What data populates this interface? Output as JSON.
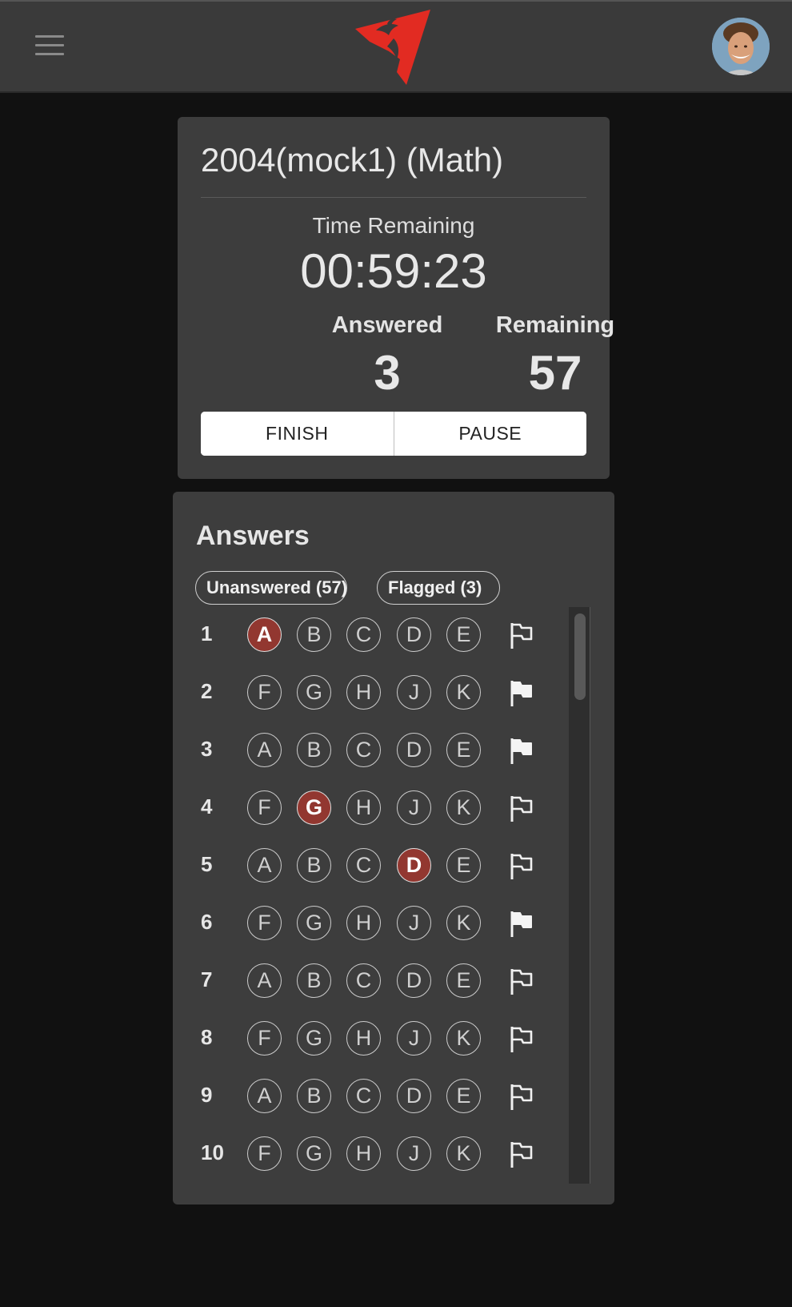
{
  "header": {
    "menu_icon": "hamburger-icon",
    "logo_icon": "red-bird-logo-icon",
    "avatar_icon": "user-avatar"
  },
  "exam": {
    "title": "2004(mock1) (Math)",
    "time_label": "Time Remaining",
    "time_value": "00:59:23",
    "answered_label": "Answered",
    "answered_value": "3",
    "remaining_label": "Remaining",
    "remaining_value": "57",
    "finish_label": "FINISH",
    "pause_label": "PAUSE"
  },
  "answers": {
    "title": "Answers",
    "filter_unanswered": "Unanswered (57)",
    "filter_flagged": "Flagged (3)",
    "rows": [
      {
        "num": "1",
        "options": [
          "A",
          "B",
          "C",
          "D",
          "E"
        ],
        "selected": "A",
        "flagged": false
      },
      {
        "num": "2",
        "options": [
          "F",
          "G",
          "H",
          "J",
          "K"
        ],
        "selected": null,
        "flagged": true
      },
      {
        "num": "3",
        "options": [
          "A",
          "B",
          "C",
          "D",
          "E"
        ],
        "selected": null,
        "flagged": true
      },
      {
        "num": "4",
        "options": [
          "F",
          "G",
          "H",
          "J",
          "K"
        ],
        "selected": "G",
        "flagged": false
      },
      {
        "num": "5",
        "options": [
          "A",
          "B",
          "C",
          "D",
          "E"
        ],
        "selected": "D",
        "flagged": false
      },
      {
        "num": "6",
        "options": [
          "F",
          "G",
          "H",
          "J",
          "K"
        ],
        "selected": null,
        "flagged": true
      },
      {
        "num": "7",
        "options": [
          "A",
          "B",
          "C",
          "D",
          "E"
        ],
        "selected": null,
        "flagged": false
      },
      {
        "num": "8",
        "options": [
          "F",
          "G",
          "H",
          "J",
          "K"
        ],
        "selected": null,
        "flagged": false
      },
      {
        "num": "9",
        "options": [
          "A",
          "B",
          "C",
          "D",
          "E"
        ],
        "selected": null,
        "flagged": false
      },
      {
        "num": "10",
        "options": [
          "F",
          "G",
          "H",
          "J",
          "K"
        ],
        "selected": null,
        "flagged": false
      }
    ]
  },
  "colors": {
    "accent_red": "#923730",
    "logo_red": "#e22b22",
    "card_bg": "#3d3d3d",
    "page_bg": "#111111"
  }
}
